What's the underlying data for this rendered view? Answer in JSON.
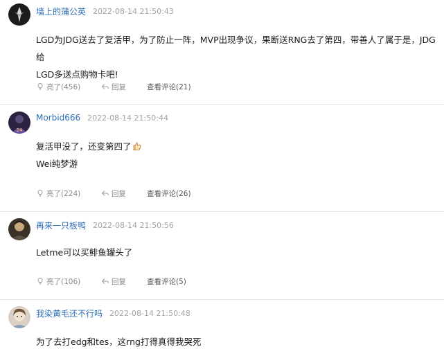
{
  "comments": [
    {
      "username": "墙上的蒲公英",
      "time": "2022-08-14 21:50:43",
      "lines": [
        "LGD为JDG送去了复活甲，为了防止一阵，MVP出现争议，果断送RNG去了第四，带善人了属于是，JDG给",
        "LGD多送点购物卡吧!"
      ],
      "like_label": "亮了(456)",
      "reply_label": "回复",
      "view_label": "查看评论(21)"
    },
    {
      "username": "Morbid666",
      "time": "2022-08-14 21:50:44",
      "lines": [
        "复活甲没了，还变第四了",
        "Wei纯梦游"
      ],
      "like_label": "亮了(224)",
      "reply_label": "回复",
      "view_label": "查看评论(26)"
    },
    {
      "username": "再来一只板鸭",
      "time": "2022-08-14 21:50:56",
      "lines": [
        "Letme可以买鲱鱼罐头了"
      ],
      "like_label": "亮了(106)",
      "reply_label": "回复",
      "view_label": "查看评论(5)"
    },
    {
      "username": "我染黄毛还不行吗",
      "time": "2022-08-14 21:50:48",
      "lines": [
        "为了去打edg和tes，这rng打得真得我哭死"
      ]
    }
  ],
  "icons": {
    "like": "like-icon",
    "reply": "reply-icon",
    "thumbs_up_emoji": "thumbs-up-emoji"
  },
  "colors": {
    "username": "#2f6fb5",
    "meta": "#a3a3a3",
    "divider": "#e6e6e6"
  }
}
